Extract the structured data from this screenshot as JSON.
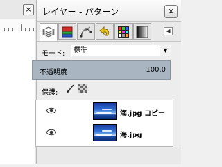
{
  "panel": {
    "title": "レイヤー - パターン",
    "close_symbol": "×",
    "menu_symbol": "◀"
  },
  "tabs": [
    {
      "name": "layers",
      "icon": "layers-icon",
      "active": true
    },
    {
      "name": "channels",
      "icon": "channels-icon"
    },
    {
      "name": "paths",
      "icon": "paths-icon"
    },
    {
      "name": "undo",
      "icon": "undo-icon"
    },
    {
      "name": "colormap",
      "icon": "colormap-icon"
    },
    {
      "name": "gradient",
      "icon": "gradient-icon"
    }
  ],
  "mode": {
    "label": "モード:",
    "value": "標準",
    "dropdown_symbol": "▼"
  },
  "opacity": {
    "label": "不透明度",
    "value": "100.0"
  },
  "lock": {
    "label": "保護:"
  },
  "layers": [
    {
      "name": "海.jpg コピー",
      "visible": true
    },
    {
      "name": "海.jpg",
      "visible": true
    }
  ],
  "canvas": {
    "close_symbol": "×"
  }
}
